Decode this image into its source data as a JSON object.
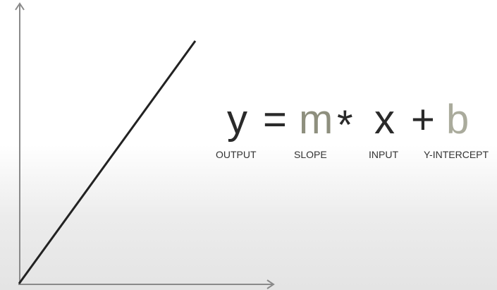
{
  "equation": {
    "symbols": [
      "y",
      "=",
      "m",
      "*",
      "x",
      "+",
      "b"
    ],
    "labels": [
      "OUTPUT",
      "SLOPE",
      "INPUT",
      "Y-INTERCEPT"
    ]
  },
  "colors": {
    "text": "#2a2a2a",
    "slope": "#8e8f7e",
    "intercept": "#aaab9c",
    "axes": "#8a8a8a",
    "line": "#222222"
  }
}
